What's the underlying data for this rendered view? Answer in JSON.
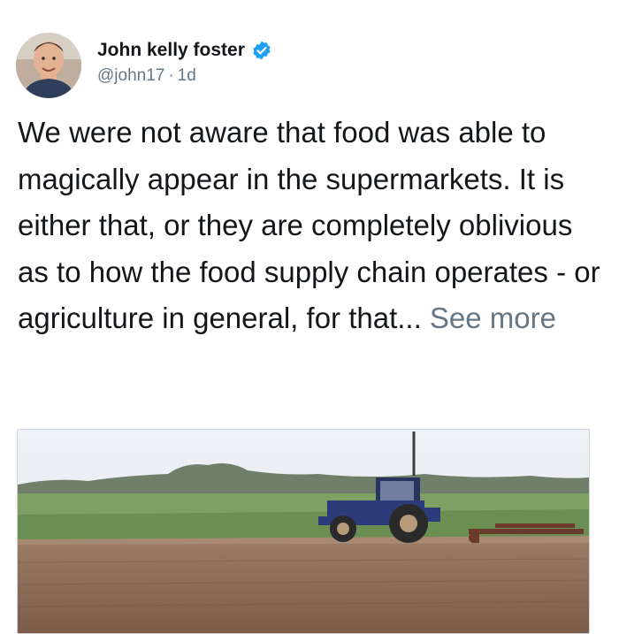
{
  "tweet": {
    "author": {
      "name": "John kelly foster",
      "handle": "@john17",
      "time": "1d",
      "separator": "·",
      "verified": true,
      "avatar_icon": "user-avatar"
    },
    "text": "We were not aware that food was able to magically appear in the supermarkets. It is either that, or they are completely oblivious as to how the food supply chain operates - or agriculture in general, for that...",
    "see_more": "See more",
    "media_icon": "tractor-field-photo"
  },
  "colors": {
    "text": "#14171a",
    "secondary": "#657786",
    "verified_blue": "#1da1f2",
    "sky": "#e6edf3",
    "field_green": "#6f9a57",
    "soil": "#8a6a55",
    "tractor": "#2b3a78"
  }
}
